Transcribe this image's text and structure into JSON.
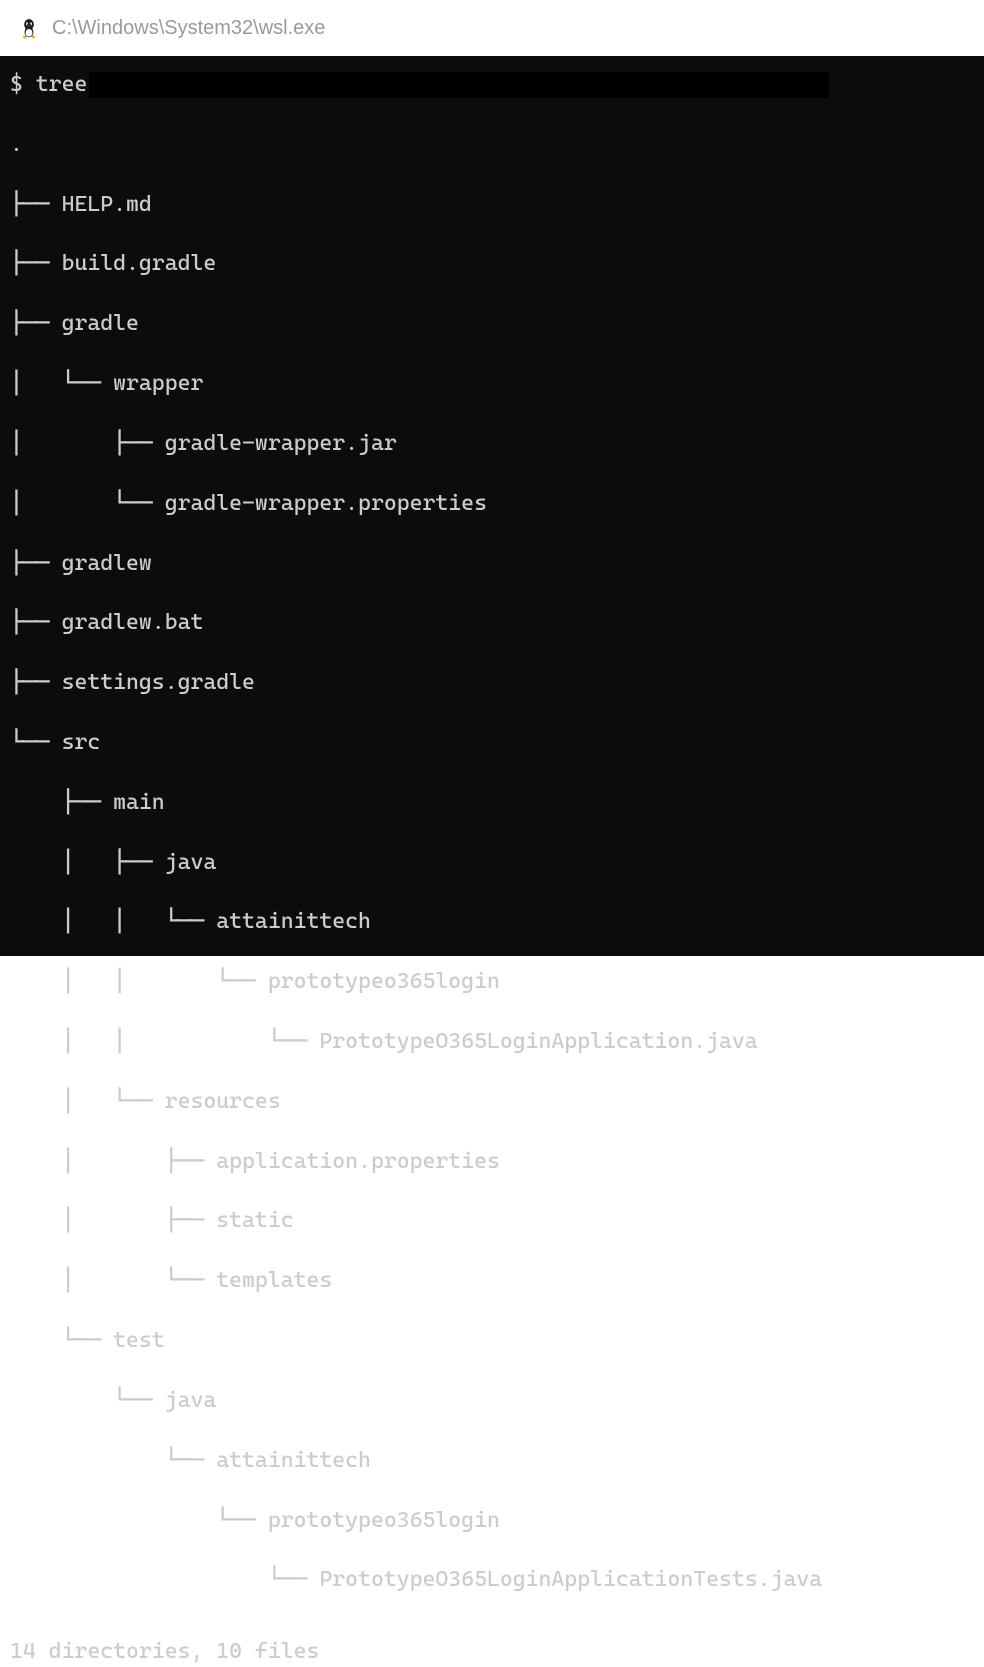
{
  "titlebar": {
    "title": "C:\\Windows\\System32\\wsl.exe"
  },
  "prompt": "$ ",
  "command": "tree",
  "rows": [
    ".",
    "├── HELP.md",
    "├── build.gradle",
    "├── gradle",
    "│   └── wrapper",
    "│       ├── gradle-wrapper.jar",
    "│       └── gradle-wrapper.properties",
    "├── gradlew",
    "├── gradlew.bat",
    "├── settings.gradle",
    "└── src",
    "    ├── main",
    "    │   ├── java",
    "    │   │   └── attainittech",
    "    │   │       └── prototypeo365login",
    "    │   │           └── PrototypeO365LoginApplication.java",
    "    │   └── resources",
    "    │       ├── application.properties",
    "    │       ├── static",
    "    │       └── templates",
    "    └── test",
    "        └── java",
    "            └── attainittech",
    "                └── prototypeo365login",
    "                    └── PrototypeO365LoginApplicationTests.java"
  ],
  "summary": "14 directories, 10 files"
}
